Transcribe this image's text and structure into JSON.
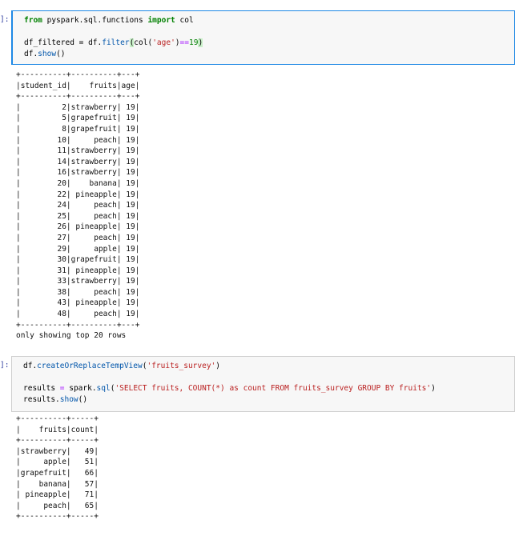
{
  "cell1": {
    "prompt": "]:",
    "code": {
      "line1_kw_from": "from",
      "line1_module": " pyspark.sql.functions ",
      "line1_kw_import": "import",
      "line1_name": " col",
      "line3_prefix": "df_filtered = df.",
      "line3_call": "filter",
      "line3_paren_open": "(",
      "line3_col": "col(",
      "line3_str": "'age'",
      "line3_close": ")",
      "line3_op": "==",
      "line3_num": "19",
      "line3_paren_close": ")",
      "line4_obj": "df.",
      "line4_call": "show",
      "line4_paren": "()"
    }
  },
  "output1": {
    "border_top": "+----------+----------+---+",
    "header": "|student_id|    fruits|age|",
    "border_mid": "+----------+----------+---+",
    "rows": [
      "|         2|strawberry| 19|",
      "|         5|grapefruit| 19|",
      "|         8|grapefruit| 19|",
      "|        10|     peach| 19|",
      "|        11|strawberry| 19|",
      "|        14|strawberry| 19|",
      "|        16|strawberry| 19|",
      "|        20|    banana| 19|",
      "|        22| pineapple| 19|",
      "|        24|     peach| 19|",
      "|        25|     peach| 19|",
      "|        26| pineapple| 19|",
      "|        27|     peach| 19|",
      "|        29|     apple| 19|",
      "|        30|grapefruit| 19|",
      "|        31| pineapple| 19|",
      "|        33|strawberry| 19|",
      "|        38|     peach| 19|",
      "|        43| pineapple| 19|",
      "|        48|     peach| 19|"
    ],
    "border_bottom": "+----------+----------+---+",
    "footer": "only showing top 20 rows"
  },
  "cell2": {
    "prompt": "]:",
    "code": {
      "line1_obj": "df.",
      "line1_call": "createOrReplaceTempView",
      "line1_open": "(",
      "line1_str": "'fruits_survey'",
      "line1_close": ")",
      "line3_prefix": "results ",
      "line3_eq": "=",
      "line3_mid": " spark.",
      "line3_call": "sql",
      "line3_open": "(",
      "line3_str": "'SELECT fruits, COUNT(*) as count FROM fruits_survey GROUP BY fruits'",
      "line3_close": ")",
      "line4_obj": "results.",
      "line4_call": "show",
      "line4_paren": "()"
    }
  },
  "output2": {
    "border_top": "+----------+-----+",
    "header": "|    fruits|count|",
    "border_mid": "+----------+-----+",
    "rows": [
      "|strawberry|   49|",
      "|     apple|   51|",
      "|grapefruit|   66|",
      "|    banana|   57|",
      "| pineapple|   71|",
      "|     peach|   65|"
    ],
    "border_bottom": "+----------+-----+"
  },
  "colors": {
    "keyword": "#008000",
    "string": "#ba2121",
    "function": "#0055aa",
    "operator": "#aa22ff",
    "active_cell_border": "#1e88e5",
    "prompt": "#303f9f"
  }
}
